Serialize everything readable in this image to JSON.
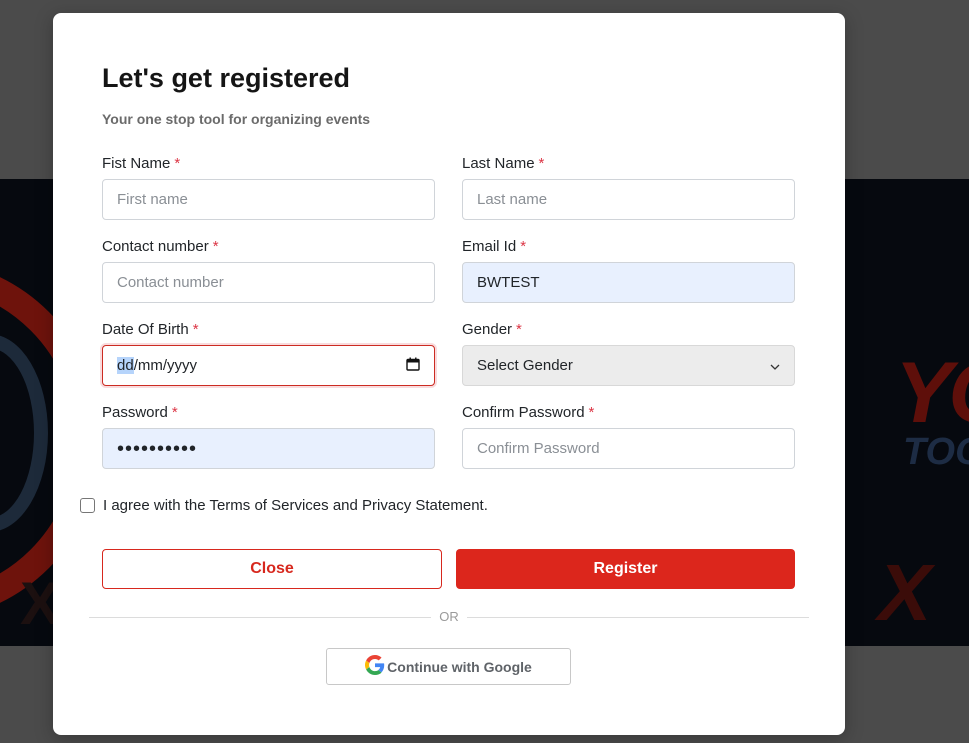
{
  "modal": {
    "title": "Let's get registered",
    "subtitle": "Your one stop tool for organizing events"
  },
  "form": {
    "first_name": {
      "label": "Fist Name",
      "placeholder": "First name",
      "required_mark": "*"
    },
    "last_name": {
      "label": "Last Name",
      "placeholder": "Last name",
      "required_mark": "*"
    },
    "contact_number": {
      "label": "Contact number",
      "placeholder": "Contact number",
      "required_mark": "*"
    },
    "email": {
      "label": "Email Id",
      "value": "BWTEST",
      "required_mark": "*"
    },
    "dob": {
      "label": "Date Of Birth",
      "value_dd": "dd",
      "value_rest": "/mm/yyyy",
      "required_mark": "*"
    },
    "gender": {
      "label": "Gender",
      "selected": "Select Gender",
      "required_mark": "*"
    },
    "password": {
      "label": "Password",
      "value": "••••••••••",
      "required_mark": "*"
    },
    "confirm_password": {
      "label": "Confirm Password",
      "placeholder": "Confirm Password",
      "required_mark": "*"
    },
    "agree_text": "I agree with the Terms of Services and Privacy Statement."
  },
  "buttons": {
    "close": "Close",
    "register": "Register",
    "or": "OR",
    "google": "Continue with Google"
  },
  "background": {
    "word1": "YO",
    "word2": "TOO",
    "word3": "X",
    "word4": "X"
  },
  "colors": {
    "accent": "#dc261c",
    "required": "#dc3545",
    "autofill": "#e8f0fe"
  }
}
